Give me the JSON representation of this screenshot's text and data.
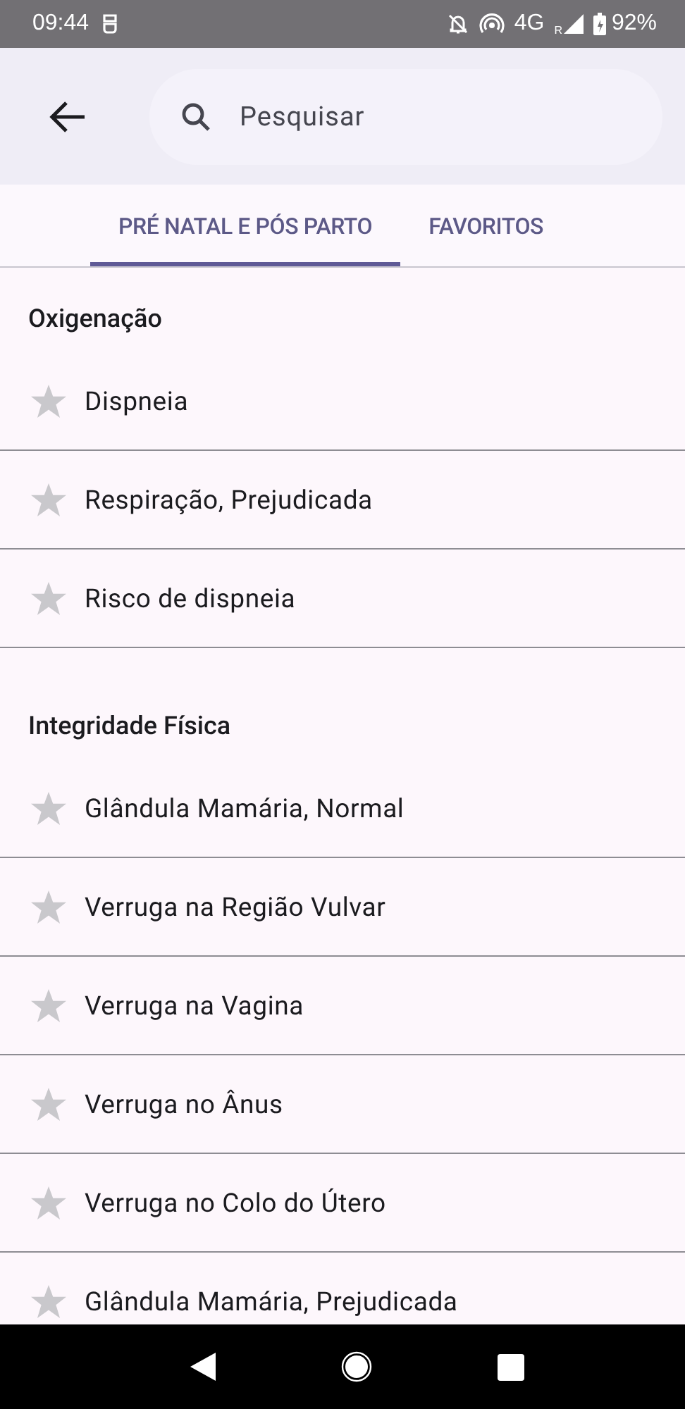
{
  "status_bar": {
    "time": "09:44",
    "network": "4G",
    "roaming": "R",
    "battery": "92%"
  },
  "search": {
    "placeholder": "Pesquisar"
  },
  "tabs": [
    {
      "label": "PRÉ NATAL E PÓS PARTO",
      "selected": true
    },
    {
      "label": "FAVORITOS",
      "selected": false
    }
  ],
  "sections": [
    {
      "title": "Oxigenação",
      "items": [
        {
          "label": "Dispneia",
          "favorite": false
        },
        {
          "label": "Respiração, Prejudicada",
          "favorite": false
        },
        {
          "label": "Risco de dispneia",
          "favorite": false
        }
      ]
    },
    {
      "title": "Integridade Física",
      "items": [
        {
          "label": "Glândula Mamária, Normal",
          "favorite": false
        },
        {
          "label": "Verruga na Região Vulvar",
          "favorite": false
        },
        {
          "label": "Verruga na Vagina",
          "favorite": false
        },
        {
          "label": "Verruga no Ânus",
          "favorite": false
        },
        {
          "label": "Verruga no Colo do Útero",
          "favorite": false
        },
        {
          "label": "Glândula Mamária, Prejudicada",
          "favorite": false
        }
      ]
    }
  ]
}
